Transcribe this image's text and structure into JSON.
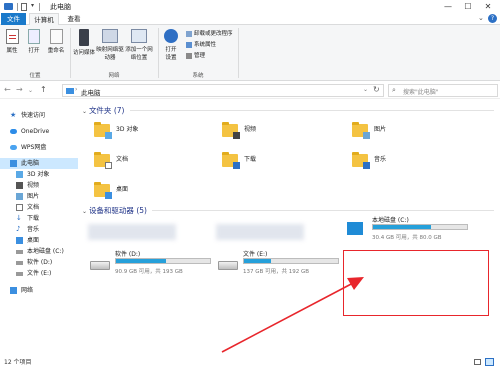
{
  "titlebar": {
    "title": "此电脑",
    "controls": [
      "—",
      "☐",
      "✕"
    ]
  },
  "ribbon_tabs": {
    "file": "文件",
    "computer": "计算机",
    "view": "查看"
  },
  "ribbon": {
    "groups": {
      "location": {
        "label": "位置",
        "buttons": [
          "属性",
          "打开",
          "重命名"
        ]
      },
      "network": {
        "label": "网络",
        "buttons": [
          "访问媒体",
          "映射网络驱动器",
          "添加一个网络位置"
        ]
      },
      "system": {
        "label": "系统",
        "buttons": [
          "打开设置"
        ],
        "small": [
          "卸载或更改程序",
          "系统属性",
          "管理"
        ]
      }
    }
  },
  "address": {
    "path": "此电脑",
    "search_placeholder": "搜索\"此电脑\""
  },
  "nav": {
    "items": [
      {
        "label": "快速访问",
        "icon": "star-icon"
      },
      {
        "label": "OneDrive",
        "icon": "cloud-icon"
      },
      {
        "label": "WPS网盘",
        "icon": "cloud-icon"
      },
      {
        "label": "此电脑",
        "icon": "computer-icon",
        "selected": true
      },
      {
        "label": "3D 对象",
        "icon": "cube-icon"
      },
      {
        "label": "视频",
        "icon": "video-icon"
      },
      {
        "label": "图片",
        "icon": "picture-icon"
      },
      {
        "label": "文档",
        "icon": "document-icon"
      },
      {
        "label": "下载",
        "icon": "download-icon"
      },
      {
        "label": "音乐",
        "icon": "music-icon"
      },
      {
        "label": "桌面",
        "icon": "desktop-icon"
      },
      {
        "label": "本地磁盘 (C:)",
        "icon": "drive-icon"
      },
      {
        "label": "软件 (D:)",
        "icon": "drive-icon"
      },
      {
        "label": "文件 (E:)",
        "icon": "drive-icon"
      },
      {
        "label": "网络",
        "icon": "network-icon"
      }
    ]
  },
  "folders": {
    "header": "文件夹 (7)",
    "items": [
      "3D 对象",
      "视频",
      "图片",
      "文档",
      "下载",
      "音乐",
      "桌面"
    ]
  },
  "drives": {
    "header": "设备和驱动器 (5)",
    "items": [
      {
        "name": "本地磁盘 (C:)",
        "capacity": "30.4 GB 可用，共 80.0 GB",
        "used_fraction": 0.62
      },
      {
        "name": "软件 (D:)",
        "capacity": "90.9 GB 可用，共 193 GB",
        "used_fraction": 0.53
      },
      {
        "name": "文件 (E:)",
        "capacity": "137 GB 可用，共 192 GB",
        "used_fraction": 0.29
      }
    ]
  },
  "status": {
    "count": "12 个项目"
  },
  "colors": {
    "accent": "#1979ca",
    "highlight": "#e8262c",
    "drive_bar": "#26a0da"
  }
}
